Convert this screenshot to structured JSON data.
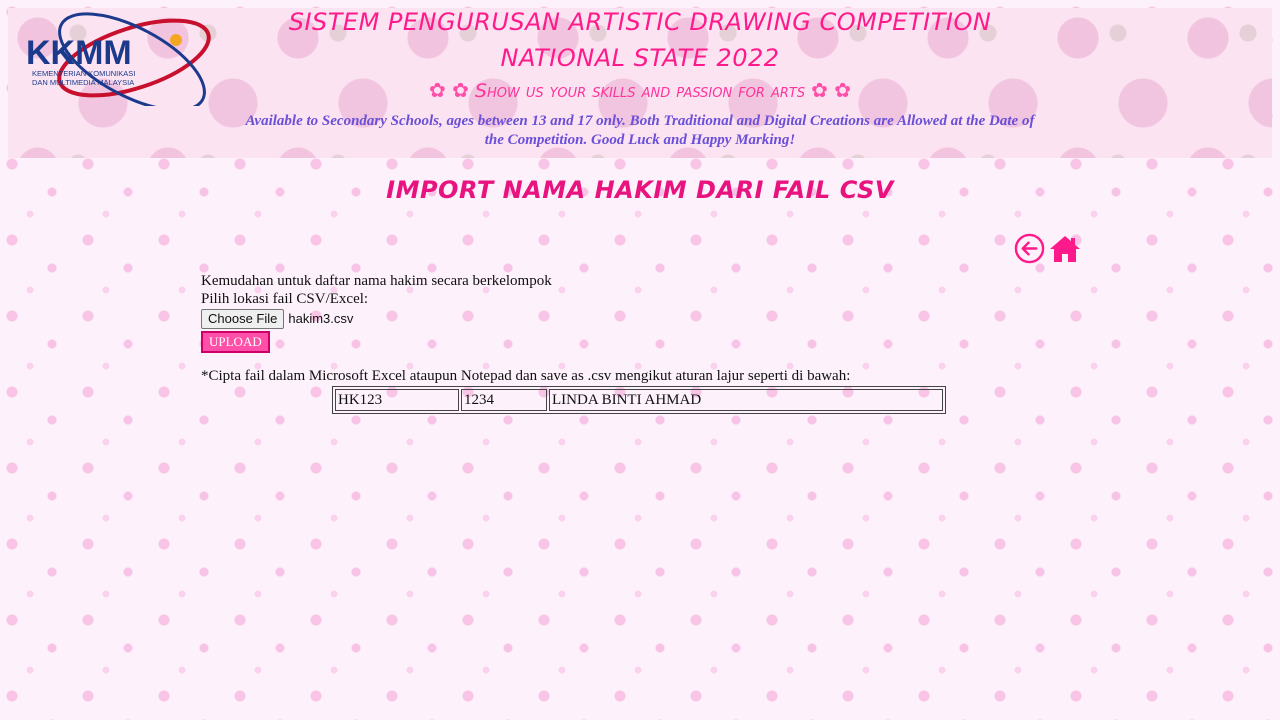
{
  "header": {
    "logo_text": "KKMM",
    "logo_subtext_line1": "KEMENTERIAN KOMUNIKASI",
    "logo_subtext_line2": "DAN MULTIMEDIA MALAYSIA",
    "title_line1": "SISTEM PENGURUSAN ARTISTIC DRAWING COMPETITION",
    "title_line2": "NATIONAL STATE 2022",
    "tagline": "Show us your skills and passion for arts",
    "subtitle": "Available to Secondary Schools, ages between 13 and 17 only. Both Traditional and Digital Creations are Allowed at the Date of the Competition. Good Luck and Happy Marking!"
  },
  "page": {
    "heading": "IMPORT NAMA HAKIM DARI FAIL CSV"
  },
  "nav": {
    "back_icon": "back-arrow-circle-icon",
    "home_icon": "home-icon",
    "accent_color": "#ff1a8c"
  },
  "form": {
    "intro": "Kemudahan untuk daftar nama hakim secara berkelompok",
    "file_label": "Pilih lokasi fail CSV/Excel:",
    "choose_file_label": "Choose File",
    "selected_file": "hakim3.csv",
    "upload_label": "UPLOAD"
  },
  "note": {
    "text": "*Cipta fail dalam Microsoft Excel ataupun Notepad dan save as .csv mengikut aturan lajur seperti di bawah:"
  },
  "sample_table": {
    "cells": [
      "HK123",
      "1234",
      "LINDA BINTI AHMAD"
    ]
  }
}
